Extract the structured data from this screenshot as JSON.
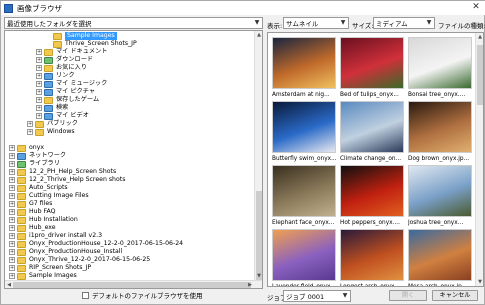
{
  "window": {
    "title": "画像ブラウザ",
    "close_glyph": "✕"
  },
  "left": {
    "recent_folder_label": "最近使用したフォルダを選択",
    "tree": [
      {
        "label": "Sample Images",
        "indent": 4,
        "expander": "",
        "icon": "folder",
        "selected": true
      },
      {
        "label": "Thrive_Screen Shots_JP",
        "indent": 4,
        "expander": "",
        "icon": "folder",
        "selected": false
      },
      {
        "label": "マイ ドキュメント",
        "indent": 3,
        "expander": "+",
        "icon": "folder",
        "selected": false
      },
      {
        "label": "ダウンロード",
        "indent": 3,
        "expander": "+",
        "icon": "green",
        "selected": false
      },
      {
        "label": "お気に入り",
        "indent": 3,
        "expander": "+",
        "icon": "folder",
        "selected": false
      },
      {
        "label": "リンク",
        "indent": 3,
        "expander": "+",
        "icon": "blue",
        "selected": false
      },
      {
        "label": "マイ ミュージック",
        "indent": 3,
        "expander": "+",
        "icon": "blue",
        "selected": false
      },
      {
        "label": "マイ ピクチャ",
        "indent": 3,
        "expander": "+",
        "icon": "blue",
        "selected": false
      },
      {
        "label": "保存したゲーム",
        "indent": 3,
        "expander": "+",
        "icon": "folder",
        "selected": false
      },
      {
        "label": "検索",
        "indent": 3,
        "expander": "+",
        "icon": "blue",
        "selected": false
      },
      {
        "label": "マイ ビデオ",
        "indent": 3,
        "expander": "+",
        "icon": "blue",
        "selected": false
      },
      {
        "label": "パブリック",
        "indent": 2,
        "expander": "+",
        "icon": "folder",
        "selected": false
      },
      {
        "label": "Windows",
        "indent": 2,
        "expander": "+",
        "icon": "folder",
        "selected": false
      },
      {
        "label": "",
        "indent": 0,
        "expander": "",
        "icon": "",
        "selected": false
      },
      {
        "label": "onyx",
        "indent": 0,
        "expander": "+",
        "icon": "folder",
        "selected": false
      },
      {
        "label": "ネットワーク",
        "indent": 0,
        "expander": "+",
        "icon": "blue",
        "selected": false
      },
      {
        "label": "ライブラリ",
        "indent": 0,
        "expander": "+",
        "icon": "green",
        "selected": false
      },
      {
        "label": "12_2_PH_Help_Screen Shots",
        "indent": 0,
        "expander": "+",
        "icon": "folder",
        "selected": false
      },
      {
        "label": "12_2_Thrive_Help Screen shots",
        "indent": 0,
        "expander": "+",
        "icon": "folder",
        "selected": false
      },
      {
        "label": "Auto_Scripts",
        "indent": 0,
        "expander": "+",
        "icon": "folder",
        "selected": false
      },
      {
        "label": "Cutting Image Files",
        "indent": 0,
        "expander": "+",
        "icon": "folder",
        "selected": false
      },
      {
        "label": "G7 files",
        "indent": 0,
        "expander": "+",
        "icon": "folder",
        "selected": false
      },
      {
        "label": "Hub FAQ",
        "indent": 0,
        "expander": "+",
        "icon": "folder",
        "selected": false
      },
      {
        "label": "Hub Installation",
        "indent": 0,
        "expander": "+",
        "icon": "folder",
        "selected": false
      },
      {
        "label": "Hub_exe",
        "indent": 0,
        "expander": "+",
        "icon": "folder",
        "selected": false
      },
      {
        "label": "i1pro_driver install v2.3",
        "indent": 0,
        "expander": "+",
        "icon": "folder",
        "selected": false
      },
      {
        "label": "Onyx_ProductionHouse_12-2-0_2017-06-15-06-24",
        "indent": 0,
        "expander": "+",
        "icon": "folder",
        "selected": false
      },
      {
        "label": "Onyx_ProductionHouse_Install",
        "indent": 0,
        "expander": "+",
        "icon": "folder",
        "selected": false
      },
      {
        "label": "Onyx_Thrive_12-2-0_2017-06-15-06-25",
        "indent": 0,
        "expander": "+",
        "icon": "folder",
        "selected": false
      },
      {
        "label": "RIP_Screen Shots_JP",
        "indent": 0,
        "expander": "+",
        "icon": "folder",
        "selected": false
      },
      {
        "label": "Sample Images",
        "indent": 0,
        "expander": "+",
        "icon": "folder",
        "selected": false
      }
    ],
    "default_browser_label": "デフォルトのファイルブラウザを使用"
  },
  "right": {
    "view_label": "表示:",
    "view_value": "サムネイル",
    "size_label": "サイズ:",
    "size_value": "ミディアム",
    "filetype_label": "ファイルの種類:",
    "thumbnails": [
      {
        "caption": "Amsterdam at nig...",
        "colors": [
          "#1a2540",
          "#c06a2a",
          "#f0c060"
        ]
      },
      {
        "caption": "Bed of tulips_onyx...",
        "colors": [
          "#6a1020",
          "#d0303a",
          "#3a6a2a"
        ]
      },
      {
        "caption": "Bonsai tree_onyx....",
        "colors": [
          "#d8d8d8",
          "#f4f4f4",
          "#3a6a30"
        ]
      },
      {
        "caption": "Butterfly swim_onyx...",
        "colors": [
          "#0a1a3a",
          "#2a6ac8",
          "#e8e8f0"
        ]
      },
      {
        "caption": "Climate change_on...",
        "colors": [
          "#5a8ac0",
          "#c0d0e0",
          "#2a3a5a"
        ]
      },
      {
        "caption": "Dog brown_onyx.jp...",
        "colors": [
          "#2a1a10",
          "#b07040",
          "#e0b070"
        ]
      },
      {
        "caption": "Elephant face_onyx...",
        "colors": [
          "#3a3020",
          "#8a7a5a",
          "#c0b090"
        ]
      },
      {
        "caption": "Hot peppers_onyx....",
        "colors": [
          "#101010",
          "#c02010",
          "#e06020"
        ]
      },
      {
        "caption": "Joshua tree_onyx...",
        "colors": [
          "#e0e8f0",
          "#7aa0c8",
          "#4a5a30"
        ]
      },
      {
        "caption": "Lavender field_onyx...",
        "colors": [
          "#f0a050",
          "#8a60c0",
          "#5a3a90"
        ]
      },
      {
        "caption": "Longest arch_onyx...",
        "colors": [
          "#2a1a3a",
          "#c05020",
          "#e09040"
        ]
      },
      {
        "caption": "Mesa arch_onyx.jp...",
        "colors": [
          "#3a6aa0",
          "#d08040",
          "#8a4020"
        ]
      }
    ],
    "job_label": "ジョブ:",
    "job_value": "ジョブ 0001",
    "open_button": "開く",
    "cancel_button": "キャンセル"
  }
}
